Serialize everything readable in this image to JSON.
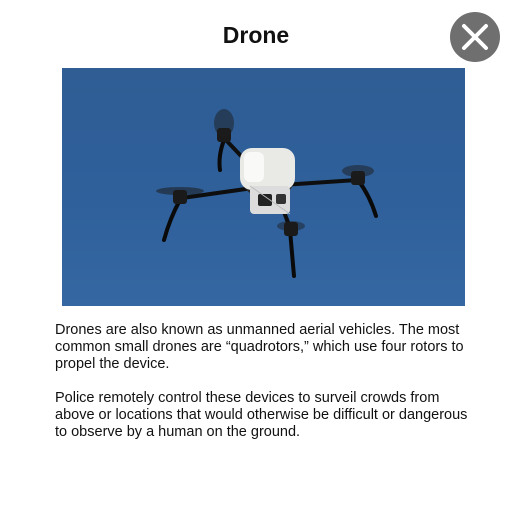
{
  "dialog": {
    "title": "Drone",
    "close_icon": "close-icon",
    "image_subject": "quadrotor-drone",
    "paragraphs": [
      "Drones are also known as unmanned aerial vehicles. The most common small drones are “quadrotors,” which use four rotors to propel the device.",
      "Police remotely control these devices to surveil crowds from above or locations that would otherwise be difficult or dangerous to observe by a human on the ground."
    ]
  },
  "colors": {
    "close_button_bg": "#6f6f6f",
    "sky": "#2f5e99"
  }
}
